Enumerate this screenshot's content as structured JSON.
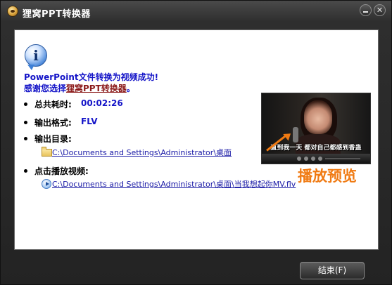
{
  "window": {
    "title": "狸窝PPT转换器"
  },
  "message": {
    "success": "PowerPoint文件转换为视频成功!",
    "thanks_prefix": "感谢您选择",
    "thanks_app": "狸窝PPT转换器",
    "thanks_suffix": "。"
  },
  "details": {
    "elapsed_label": "总共耗时:",
    "elapsed_value": "00:02:26",
    "format_label": "输出格式:",
    "format_value": "FLV",
    "output_dir_label": "输出目录:",
    "output_dir_path": "C:\\Documents and Settings\\Administrator\\桌面",
    "play_label": "点击播放视频:",
    "video_path": "C:\\Documents and Settings\\Administrator\\桌面\\当我想起你MV.flv"
  },
  "preview": {
    "caption": "直到我一天 都对自己都感到香蛊",
    "annotation": "播放预览"
  },
  "footer": {
    "finish_label": "结束(F)"
  },
  "colors": {
    "link_blue": "#1414c8",
    "app_name_red": "#8b1a1a",
    "annotation_orange": "#f07a12"
  }
}
